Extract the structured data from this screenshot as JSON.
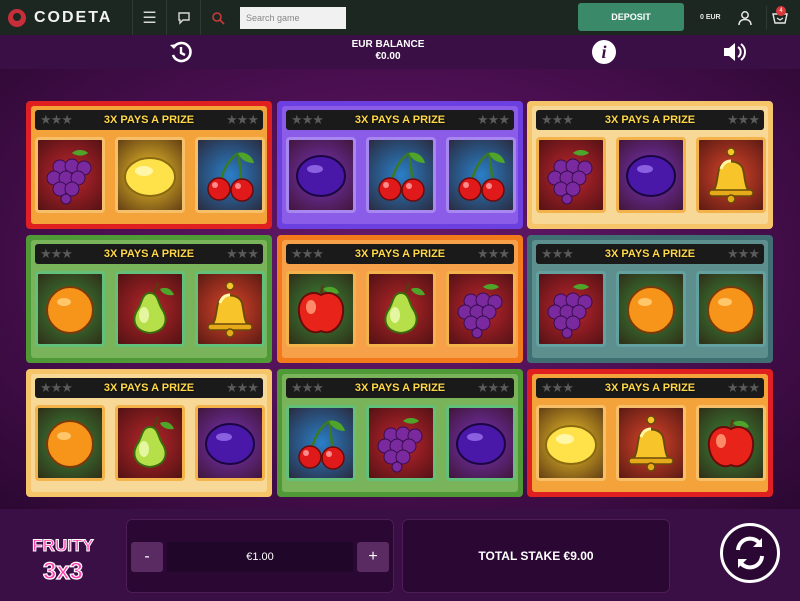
{
  "nav": {
    "brand": "CODETA",
    "search_placeholder": "Search game",
    "deposit_label": "DEPOSIT",
    "balance": "0 EUR",
    "cart_count": "4"
  },
  "header": {
    "balance_label": "EUR BALANCE",
    "balance_value": "€0.00"
  },
  "banner_text": "3X PAYS A PRIZE",
  "cards": [
    {
      "theme": "red",
      "symbols": [
        "grapes",
        "lemon",
        "cherries"
      ]
    },
    {
      "theme": "purple",
      "symbols": [
        "plum",
        "cherries",
        "cherries"
      ]
    },
    {
      "theme": "yellow",
      "symbols": [
        "grapes",
        "plum",
        "bell"
      ]
    },
    {
      "theme": "green",
      "symbols": [
        "orange",
        "pear",
        "bell"
      ]
    },
    {
      "theme": "orange",
      "symbols": [
        "apple",
        "pear",
        "grapes"
      ]
    },
    {
      "theme": "teal",
      "symbols": [
        "grapes",
        "orange",
        "orange"
      ]
    },
    {
      "theme": "yellow",
      "symbols": [
        "orange",
        "pear",
        "plum"
      ]
    },
    {
      "theme": "green",
      "symbols": [
        "cherries",
        "grapes",
        "plum"
      ]
    },
    {
      "theme": "red",
      "symbols": [
        "lemon",
        "bell",
        "apple"
      ]
    }
  ],
  "controls": {
    "stake": "€1.00",
    "minus": "-",
    "plus": "+",
    "total_stake": "TOTAL STAKE €9.00"
  },
  "game_logo": {
    "line1": "FRUITY",
    "line2": "3x3"
  },
  "colors": {
    "red": "#e02020",
    "purple": "#6c3fe0",
    "yellow": "#f6c56a",
    "green": "#4f9a36",
    "orange": "#f27a1a",
    "teal": "#3f6f72",
    "deposit": "#3a8a6a",
    "banner_text": "#ffd84a"
  },
  "icons": [
    "history-icon",
    "info-icon",
    "sound-icon",
    "menu-icon",
    "chat-icon",
    "search-icon",
    "user-icon",
    "cart-icon",
    "spin-icon"
  ]
}
